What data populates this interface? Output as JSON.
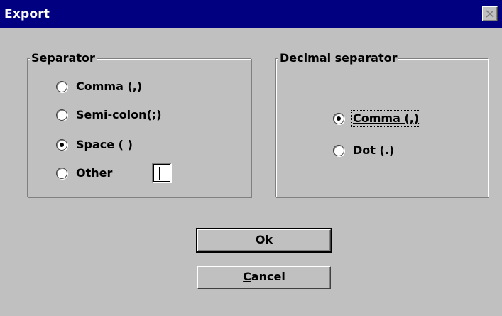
{
  "window": {
    "title": "Export",
    "close_icon": "close-icon"
  },
  "separator_group": {
    "legend": "Separator",
    "options": [
      {
        "label": "Comma (,)",
        "checked": false
      },
      {
        "label": "Semi-colon(;)",
        "checked": false
      },
      {
        "label": "Space ( )",
        "checked": true
      },
      {
        "label": "Other",
        "checked": false
      }
    ],
    "other_value": ""
  },
  "decimal_group": {
    "legend": "Decimal separator",
    "options": [
      {
        "label": "Comma (,)",
        "checked": true,
        "focused": true
      },
      {
        "label": "Dot (.)",
        "checked": false
      }
    ]
  },
  "buttons": {
    "ok_prefix": "",
    "ok_label": "Ok",
    "cancel_mnemonic": "C",
    "cancel_rest": "ancel"
  },
  "colors": {
    "titlebar": "#000080",
    "face": "#c0c0c0"
  }
}
